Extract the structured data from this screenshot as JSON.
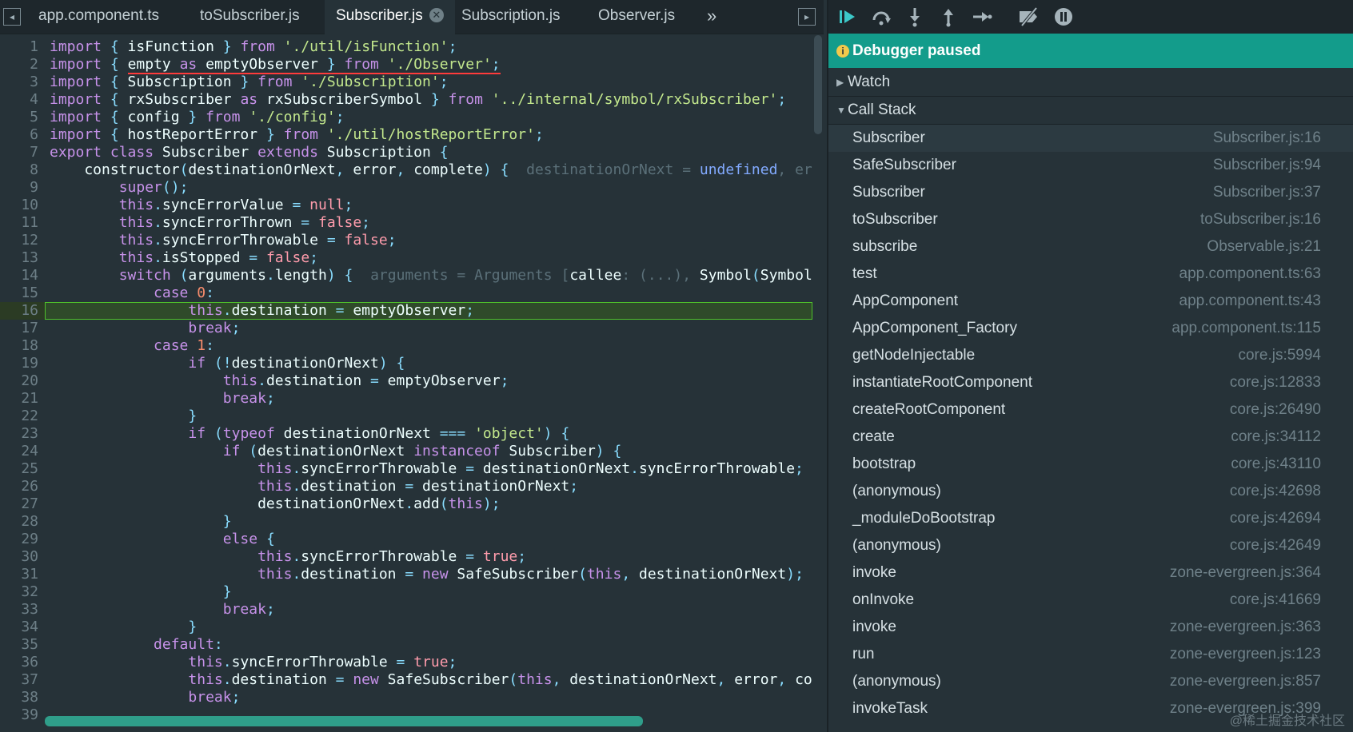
{
  "tabs": [
    {
      "label": "app.component.ts"
    },
    {
      "label": "toSubscriber.js"
    },
    {
      "label": "Subscriber.js",
      "active": true
    },
    {
      "label": "Subscription.js"
    },
    {
      "label": "Observer.js"
    }
  ],
  "tab_more": "»",
  "line_numbers": [
    "1",
    "2",
    "3",
    "4",
    "5",
    "6",
    "7",
    "8",
    "9",
    "10",
    "11",
    "12",
    "13",
    "14",
    "15",
    "16",
    "17",
    "18",
    "19",
    "20",
    "21",
    "22",
    "23",
    "24",
    "25",
    "26",
    "27",
    "28",
    "29",
    "30",
    "31",
    "32",
    "33",
    "34",
    "35",
    "36",
    "37",
    "38",
    "39"
  ],
  "debugger": {
    "paused": "Debugger paused",
    "watch": "Watch",
    "call_stack": "Call Stack",
    "frames": [
      {
        "name": "Subscriber",
        "loc": "Subscriber.js:16"
      },
      {
        "name": "SafeSubscriber",
        "loc": "Subscriber.js:94"
      },
      {
        "name": "Subscriber",
        "loc": "Subscriber.js:37"
      },
      {
        "name": "toSubscriber",
        "loc": "toSubscriber.js:16"
      },
      {
        "name": "subscribe",
        "loc": "Observable.js:21"
      },
      {
        "name": "test",
        "loc": "app.component.ts:63"
      },
      {
        "name": "AppComponent",
        "loc": "app.component.ts:43"
      },
      {
        "name": "AppComponent_Factory",
        "loc": "app.component.ts:115"
      },
      {
        "name": "getNodeInjectable",
        "loc": "core.js:5994"
      },
      {
        "name": "instantiateRootComponent",
        "loc": "core.js:12833"
      },
      {
        "name": "createRootComponent",
        "loc": "core.js:26490"
      },
      {
        "name": "create",
        "loc": "core.js:34112"
      },
      {
        "name": "bootstrap",
        "loc": "core.js:43110"
      },
      {
        "name": "(anonymous)",
        "loc": "core.js:42698"
      },
      {
        "name": "_moduleDoBootstrap",
        "loc": "core.js:42694"
      },
      {
        "name": "(anonymous)",
        "loc": "core.js:42649"
      },
      {
        "name": "invoke",
        "loc": "zone-evergreen.js:364"
      },
      {
        "name": "onInvoke",
        "loc": "core.js:41669"
      },
      {
        "name": "invoke",
        "loc": "zone-evergreen.js:363"
      },
      {
        "name": "run",
        "loc": "zone-evergreen.js:123"
      },
      {
        "name": "(anonymous)",
        "loc": "zone-evergreen.js:857"
      },
      {
        "name": "invokeTask",
        "loc": "zone-evergreen.js:399"
      }
    ]
  },
  "watermark": "@稀土掘金技术社区",
  "colors": {
    "accent": "#139c8b",
    "highlight_border": "#4fc12b",
    "underline": "#ff3b3b"
  },
  "icons": [
    "collapse-panel-icon",
    "expand-panel-icon",
    "resume-icon",
    "step-over-icon",
    "step-into-icon",
    "step-out-icon",
    "step-icon",
    "deactivate-breakpoints-icon",
    "pause-on-exceptions-icon",
    "info-icon",
    "close-icon"
  ]
}
